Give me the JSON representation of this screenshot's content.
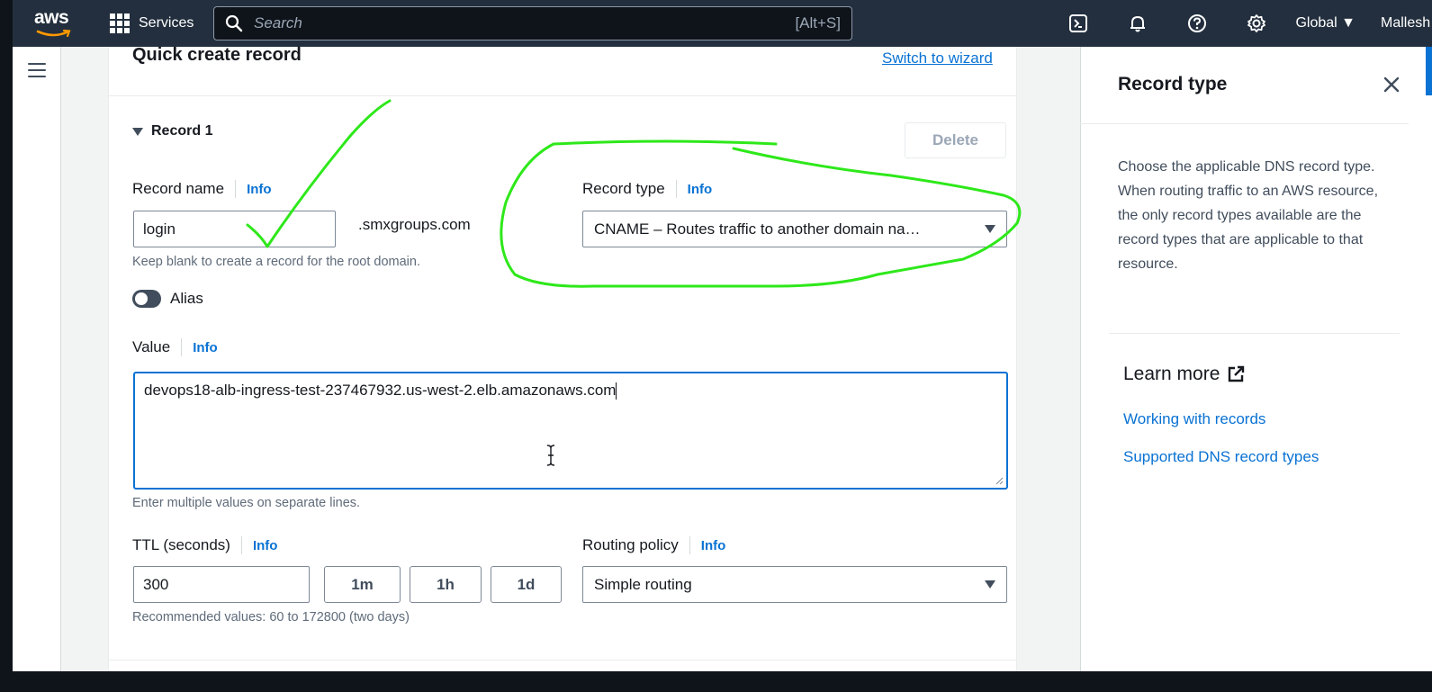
{
  "nav": {
    "logo_text": "aws",
    "services_label": "Services",
    "search_placeholder": "Search",
    "search_shortcut": "[Alt+S]",
    "icons": [
      "cloudshell-icon",
      "bell-icon",
      "help-icon",
      "gear-icon"
    ],
    "region": "Global ▼",
    "user": "Mallesh"
  },
  "form": {
    "title": "Quick create record",
    "switch_link": "Switch to wizard",
    "record_toggle": "Record 1",
    "delete_label": "Delete",
    "record_name": {
      "label": "Record name",
      "info": "Info",
      "value": "login",
      "suffix": ".smxgroups.com",
      "hint": "Keep blank to create a record for the root domain."
    },
    "record_type": {
      "label": "Record type",
      "info": "Info",
      "value": "CNAME – Routes traffic to another domain na…"
    },
    "alias_label": "Alias",
    "value_field": {
      "label": "Value",
      "info": "Info",
      "value": "devops18-alb-ingress-test-237467932.us-west-2.elb.amazonaws.com",
      "hint": "Enter multiple values on separate lines."
    },
    "ttl": {
      "label": "TTL (seconds)",
      "info": "Info",
      "value": "300",
      "presets": [
        "1m",
        "1h",
        "1d"
      ],
      "hint": "Recommended values: 60 to 172800 (two days)"
    },
    "routing": {
      "label": "Routing policy",
      "info": "Info",
      "value": "Simple routing"
    }
  },
  "help_panel": {
    "title": "Record type",
    "body": "Choose the applicable DNS record type. When routing traffic to an AWS resource, the only record types available are the record types that are applicable to that resource.",
    "learn_more": "Learn more",
    "links": [
      "Working with records",
      "Supported DNS record types"
    ]
  },
  "colors": {
    "nav_bg": "#232f3e",
    "link": "#0972d3",
    "annotation": "#2ee81a"
  }
}
